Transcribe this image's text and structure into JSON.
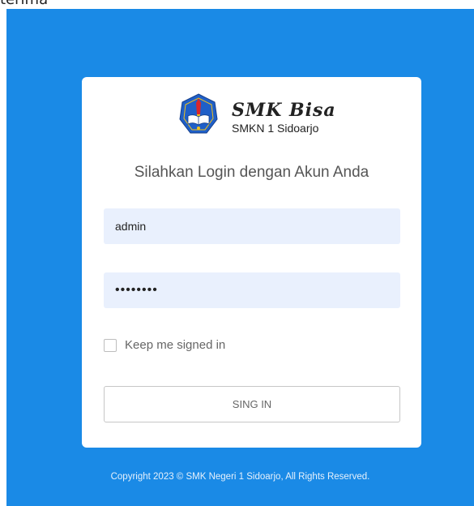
{
  "window": {
    "partial_title": "terima"
  },
  "login": {
    "logo": {
      "brand": "SMK Bisa",
      "school": "SMKN 1 Sidoarjo",
      "emblem_icon": "school-emblem-icon"
    },
    "heading": "Silahkan Login dengan Akun Anda",
    "username_value": "admin",
    "password_value": "••••••••",
    "remember_label": "Keep me signed in",
    "remember_checked": false,
    "submit_label": "SING IN"
  },
  "footer": {
    "copyright": "Copyright 2023 © SMK Negeri 1 Sidoarjo, All Rights Reserved."
  },
  "colors": {
    "background": "#1a8ae6",
    "card": "#ffffff",
    "input_fill": "#e9f0fd",
    "emblem_blue": "#1f5fc8",
    "emblem_red": "#d8262c",
    "emblem_yellow": "#f2c21a"
  }
}
